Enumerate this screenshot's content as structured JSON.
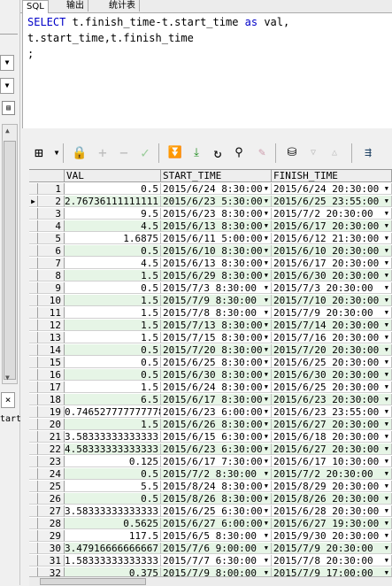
{
  "tabs": [
    "SQL",
    "输出",
    "统计表"
  ],
  "left_panel": {
    "partial_text": "tart"
  },
  "sql": {
    "line1_kw1": "SELECT",
    "line1_mid": " t.finish_time-t.start_time ",
    "line1_kw2": "as",
    "line1_end": " val,",
    "line2": "t.start_time,t.finish_time",
    "line3": ";"
  },
  "toolbar_icons": [
    "grid-view-icon",
    "lock-icon",
    "add-record-icon",
    "delete-record-icon",
    "post-edit-icon",
    "fetch-next-icon",
    "fetch-last-icon",
    "refresh-icon",
    "find-icon",
    "clear-icon",
    "export-icon",
    "filter-down-icon",
    "filter-up-icon",
    "query-plan-icon"
  ],
  "columns": [
    "VAL",
    "START_TIME",
    "FINISH_TIME"
  ],
  "current_row": 2,
  "rows": [
    {
      "no": "1",
      "val": "0.5",
      "start": "2015/6/24 8:30:00",
      "finish": "2015/6/24 20:30:00"
    },
    {
      "no": "2",
      "val": "2.76736111111111",
      "start": "2015/6/23 5:30:00",
      "finish": "2015/6/25 23:55:00"
    },
    {
      "no": "3",
      "val": "9.5",
      "start": "2015/6/23 8:30:00",
      "finish": "2015/7/2 20:30:00"
    },
    {
      "no": "4",
      "val": "4.5",
      "start": "2015/6/13 8:30:00",
      "finish": "2015/6/17 20:30:00"
    },
    {
      "no": "5",
      "val": "1.6875",
      "start": "2015/6/11 5:00:00",
      "finish": "2015/6/12 21:30:00"
    },
    {
      "no": "6",
      "val": "0.5",
      "start": "2015/6/10 8:30:00",
      "finish": "2015/6/10 20:30:00"
    },
    {
      "no": "7",
      "val": "4.5",
      "start": "2015/6/13 8:30:00",
      "finish": "2015/6/17 20:30:00"
    },
    {
      "no": "8",
      "val": "1.5",
      "start": "2015/6/29 8:30:00",
      "finish": "2015/6/30 20:30:00"
    },
    {
      "no": "9",
      "val": "0.5",
      "start": "2015/7/3 8:30:00",
      "finish": "2015/7/3 20:30:00"
    },
    {
      "no": "10",
      "val": "1.5",
      "start": "2015/7/9 8:30:00",
      "finish": "2015/7/10 20:30:00"
    },
    {
      "no": "11",
      "val": "1.5",
      "start": "2015/7/8 8:30:00",
      "finish": "2015/7/9 20:30:00"
    },
    {
      "no": "12",
      "val": "1.5",
      "start": "2015/7/13 8:30:00",
      "finish": "2015/7/14 20:30:00"
    },
    {
      "no": "13",
      "val": "1.5",
      "start": "2015/7/15 8:30:00",
      "finish": "2015/7/16 20:30:00"
    },
    {
      "no": "14",
      "val": "0.5",
      "start": "2015/7/20 8:30:00",
      "finish": "2015/7/20 20:30:00"
    },
    {
      "no": "15",
      "val": "0.5",
      "start": "2015/6/25 8:30:00",
      "finish": "2015/6/25 20:30:00"
    },
    {
      "no": "16",
      "val": "0.5",
      "start": "2015/6/30 8:30:00",
      "finish": "2015/6/30 20:30:00"
    },
    {
      "no": "17",
      "val": "1.5",
      "start": "2015/6/24 8:30:00",
      "finish": "2015/6/25 20:30:00"
    },
    {
      "no": "18",
      "val": "6.5",
      "start": "2015/6/17 8:30:00",
      "finish": "2015/6/23 20:30:00"
    },
    {
      "no": "19",
      "val": "0.746527777777778",
      "start": "2015/6/23 6:00:00",
      "finish": "2015/6/23 23:55:00"
    },
    {
      "no": "20",
      "val": "1.5",
      "start": "2015/6/26 8:30:00",
      "finish": "2015/6/27 20:30:00"
    },
    {
      "no": "21",
      "val": "3.58333333333333",
      "start": "2015/6/15 6:30:00",
      "finish": "2015/6/18 20:30:00"
    },
    {
      "no": "22",
      "val": "4.58333333333333",
      "start": "2015/6/23 6:30:00",
      "finish": "2015/6/27 20:30:00"
    },
    {
      "no": "23",
      "val": "0.125",
      "start": "2015/6/17 7:30:00",
      "finish": "2015/6/17 10:30:00"
    },
    {
      "no": "24",
      "val": "0.5",
      "start": "2015/7/2 8:30:00",
      "finish": "2015/7/2 20:30:00"
    },
    {
      "no": "25",
      "val": "5.5",
      "start": "2015/8/24 8:30:00",
      "finish": "2015/8/29 20:30:00"
    },
    {
      "no": "26",
      "val": "0.5",
      "start": "2015/8/26 8:30:00",
      "finish": "2015/8/26 20:30:00"
    },
    {
      "no": "27",
      "val": "3.58333333333333",
      "start": "2015/6/25 6:30:00",
      "finish": "2015/6/28 20:30:00"
    },
    {
      "no": "28",
      "val": "0.5625",
      "start": "2015/6/27 6:00:00",
      "finish": "2015/6/27 19:30:00"
    },
    {
      "no": "29",
      "val": "117.5",
      "start": "2015/6/5 8:30:00",
      "finish": "2015/9/30 20:30:00"
    },
    {
      "no": "30",
      "val": "3.47916666666667",
      "start": "2015/7/6 9:00:00",
      "finish": "2015/7/9 20:30:00"
    },
    {
      "no": "31",
      "val": "1.58333333333333",
      "start": "2015/7/7 6:30:00",
      "finish": "2015/7/8 20:30:00"
    },
    {
      "no": "32",
      "val": "0.375",
      "start": "2015/7/9 8:00:00",
      "finish": "2015/7/9 17:00:00"
    }
  ]
}
